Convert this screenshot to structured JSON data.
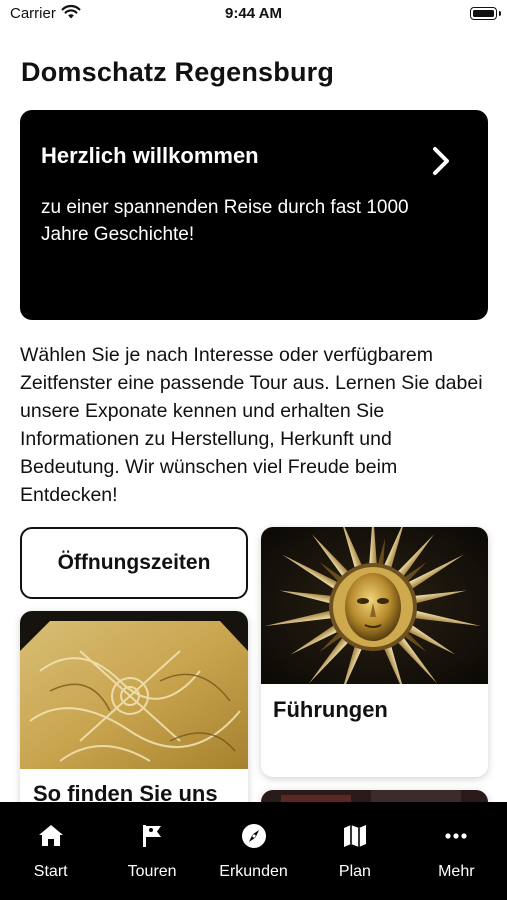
{
  "status_bar": {
    "carrier": "Carrier",
    "time": "9:44 AM"
  },
  "page": {
    "title": "Domschatz Regensburg"
  },
  "welcome_card": {
    "title": "Herzlich willkommen",
    "text": "zu einer spannenden Reise durch fast 1000 Jahre Geschichte!",
    "background": "#000000",
    "icon": "chevron-right-icon"
  },
  "intro": {
    "text": "Wählen Sie je nach Interesse oder verfügbarem Zeitfenster eine passende Tour aus. Lernen Sie dabei unsere Exponate kennen und erhalten Sie Informationen zu Herstellung, Herkunft und Bedeutung. Wir wünschen viel Freude beim Entdecken!"
  },
  "tiles": {
    "opening_hours": {
      "label": "Öffnungszeiten"
    },
    "guided_tours": {
      "label": "Führungen",
      "image": "golden-sun-monstrance-image"
    },
    "directions": {
      "label": "So finden Sie uns",
      "image": "gold-embroidered-textile-image"
    },
    "partial": {
      "image": "artifact-image"
    }
  },
  "tab_bar": {
    "background": "#000000",
    "items": [
      {
        "label": "Start",
        "icon": "home-icon"
      },
      {
        "label": "Touren",
        "icon": "flag-icon"
      },
      {
        "label": "Erkunden",
        "icon": "compass-icon"
      },
      {
        "label": "Plan",
        "icon": "map-icon"
      },
      {
        "label": "Mehr",
        "icon": "more-icon"
      }
    ]
  }
}
